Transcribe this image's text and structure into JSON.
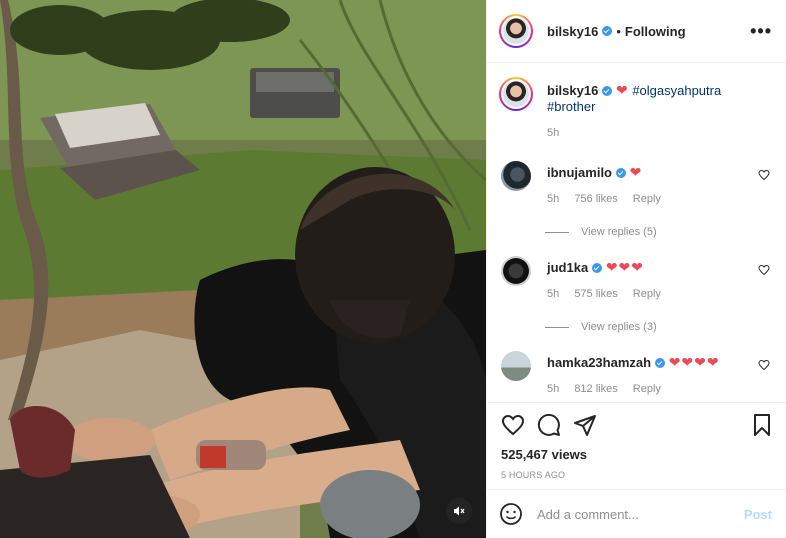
{
  "post": {
    "author": "bilsky16",
    "following_label": "Following",
    "more_label": "•••",
    "caption": {
      "username": "bilsky16",
      "emoji": "❤",
      "hashtags": [
        "#olgasyahputra",
        "#brother"
      ],
      "time": "5h"
    }
  },
  "comments": [
    {
      "username": "ibnujamilo",
      "text": "❤",
      "time": "5h",
      "likes": "756 likes",
      "reply_label": "Reply",
      "view_replies": "View replies (5)"
    },
    {
      "username": "jud1ka",
      "text": "❤❤❤",
      "time": "5h",
      "likes": "575 likes",
      "reply_label": "Reply",
      "view_replies": "View replies (3)"
    },
    {
      "username": "hamka23hamzah",
      "text": "❤❤❤❤",
      "time": "5h",
      "likes": "812 likes",
      "reply_label": "Reply"
    }
  ],
  "stats": {
    "views": "525,467 views",
    "time_ago": "5 hours ago"
  },
  "composer": {
    "placeholder": "Add a comment...",
    "post_label": "Post"
  },
  "icons": {
    "mute": "volume-muted-icon",
    "like": "heart-icon",
    "comment": "comment-bubble-icon",
    "share": "paper-plane-icon",
    "save": "bookmark-icon",
    "emoji": "emoji-smiley-icon",
    "options": "more-options-icon",
    "verified": "verified-badge-icon"
  },
  "colors": {
    "verified": "#3897f0",
    "heart": "#ed4956",
    "hashtag": "#00376b",
    "post_disabled": "#b2dffc",
    "muted_text": "#8e8e8e"
  }
}
